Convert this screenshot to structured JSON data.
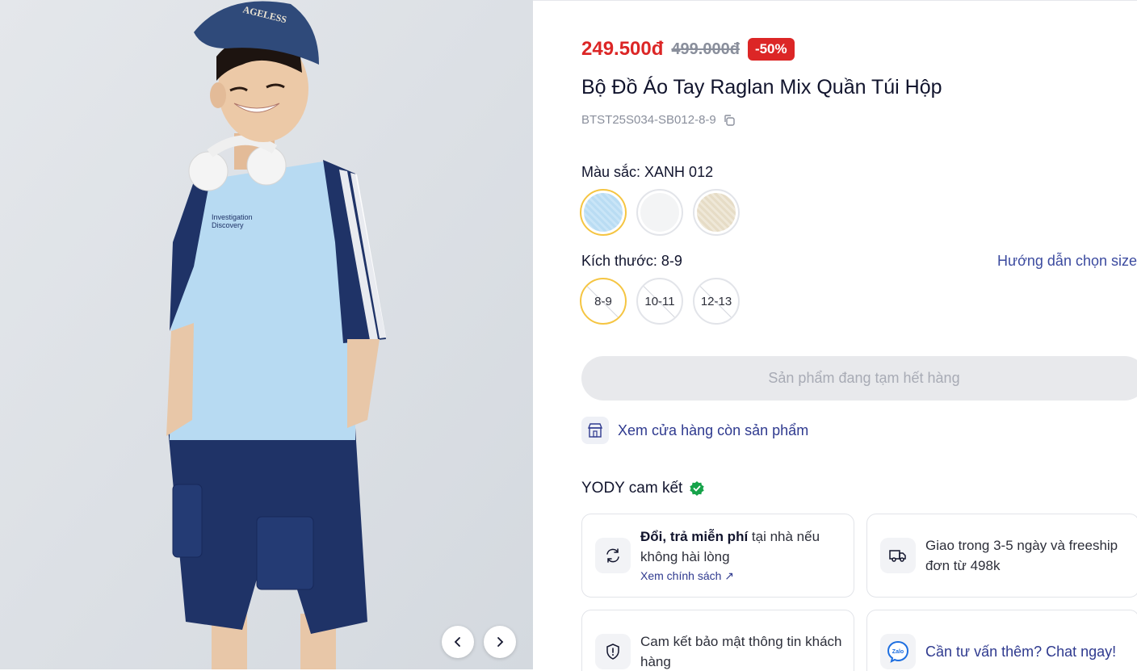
{
  "product": {
    "price_current": "249.500đ",
    "price_old": "499.000đ",
    "discount": "-50%",
    "title": "Bộ Đồ Áo Tay Raglan Mix Quần Túi Hộp",
    "sku": "BTST25S034-SB012-8-9"
  },
  "options": {
    "color_label": "Màu sắc:",
    "color_value": "XANH 012",
    "colors": [
      {
        "name": "XANH 012",
        "hex": "#b9dcf3",
        "selected": true
      },
      {
        "name": "white",
        "hex": "#f4f5f6",
        "selected": false
      },
      {
        "name": "beige",
        "hex": "#e9dfcb",
        "selected": false
      }
    ],
    "size_label": "Kích thước:",
    "size_value": "8-9",
    "size_guide": "Hướng dẫn chọn size",
    "sizes": [
      "8-9",
      "10-11",
      "12-13"
    ]
  },
  "actions": {
    "out_of_stock": "Sản phẩm đang tạm hết hàng",
    "store_link": "Xem cửa hàng còn sản phẩm"
  },
  "commitment": {
    "title": "YODY cam kết",
    "card1_bold": "Đổi, trả miễn phí",
    "card1_text": " tại nhà nếu không hài lòng",
    "card1_link": "Xem chính sách ↗",
    "card2_text": "Giao trong 3-5 ngày và freeship đơn từ 498k",
    "card3_text": "Cam kết bảo mật thông tin khách hàng",
    "card4_text": "Cần tư vấn thêm? Chat ngay!",
    "zalo_label": "Zalo"
  },
  "gallery": {
    "cap_text": "AGELESS",
    "shirt_text_1": "Investigation",
    "shirt_text_2": "Discovery"
  },
  "colors": {
    "accent_red": "#dc2626",
    "link_blue": "#2f3a8f",
    "selected_border": "#f5c542",
    "verified_green": "#16a34a"
  },
  "icons": [
    "chevron-left-icon",
    "chevron-right-icon",
    "copy-icon",
    "store-icon",
    "verified-check-icon",
    "exchange-icon",
    "truck-icon",
    "shield-icon",
    "zalo-icon"
  ]
}
